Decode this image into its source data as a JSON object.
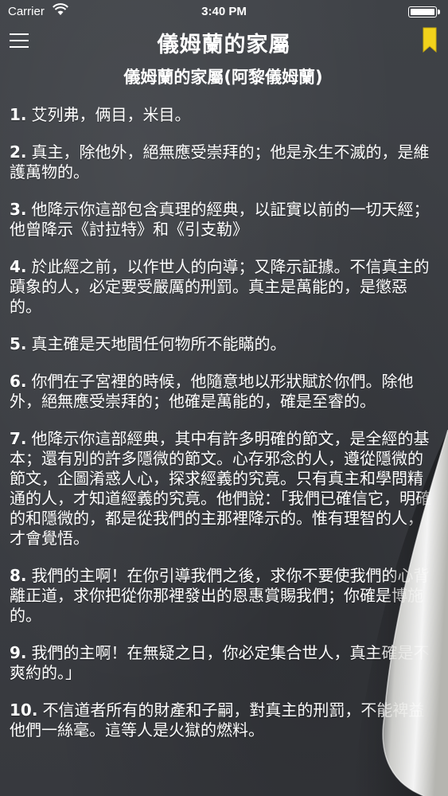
{
  "status_bar": {
    "carrier": "Carrier",
    "time": "3:40 PM"
  },
  "nav": {
    "title": "儀姆蘭的家屬",
    "menu_icon": "hamburger-menu-icon",
    "bookmark_icon": "bookmark-icon",
    "bookmark_color": "#f2d21b"
  },
  "surah": {
    "heading": "儀姆蘭的家屬(阿黎儀姆蘭)"
  },
  "verses": [
    {
      "num": "1.",
      "text": "艾列弗，俩目，米目。"
    },
    {
      "num": "2.",
      "text": "真主，除他外，絕無應受崇拜的；他是永生不滅的，是維護萬物的。"
    },
    {
      "num": "3.",
      "text": "他降示你這部包含真理的經典，以証實以前的一切天經；他曾降示《討拉特》和《引支勒》"
    },
    {
      "num": "4.",
      "text": "於此經之前，以作世人的向導；又降示証據。不信真主的蹟象的人，必定要受嚴厲的刑罰。真主是萬能的，是懲惡的。"
    },
    {
      "num": "5.",
      "text": "真主確是天地間任何物所不能瞞的。"
    },
    {
      "num": "6.",
      "text": "你們在子宮裡的時候，他隨意地以形狀賦於你們。除他外，絕無應受崇拜的；他確是萬能的，確是至睿的。"
    },
    {
      "num": "7.",
      "text": "他降示你這部經典，其中有許多明確的節文，是全經的基本；還有別的許多隱微的節文。心存邪念的人，遵從隱微的節文，企圖淆惑人心，探求經義的究竟。只有真主和學問精通的人，才知道經義的究竟。他們說：「我們已確信它，明確的和隱微的，都是從我們的主那裡降示的。惟有理智的人，才會覺悟。"
    },
    {
      "num": "8.",
      "text": "我們的主啊！在你引導我們之後，求你不要使我們的心背離正道，求你把從你那裡發出的恩惠賞賜我們；你確是博施的。"
    },
    {
      "num": "9.",
      "text": "我們的主啊！在無疑之日，你必定集合世人，真主確是不爽約的。」"
    },
    {
      "num": "10.",
      "text": "不信道者所有的財產和子嗣，對真主的刑罰，不能裨益他們一絲毫。這等人是火獄的燃料。"
    }
  ]
}
